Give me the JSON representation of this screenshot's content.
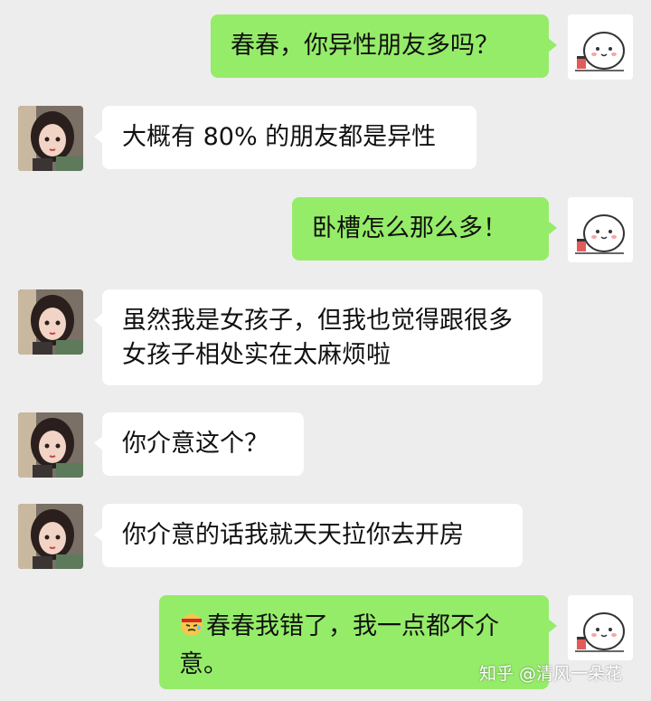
{
  "colors": {
    "background": "#ededed",
    "my_bubble": "#95ec69",
    "her_bubble": "#ffffff",
    "text": "#111111"
  },
  "icons": {
    "my_avatar": "cartoon-bun-avatar-icon",
    "her_avatar": "girl-portrait-avatar-icon",
    "sweat_emoji": "sweat-smile-emoji-icon"
  },
  "messages": [
    {
      "sender": "me",
      "text": "春春，你异性朋友多吗？"
    },
    {
      "sender": "her",
      "text": "大概有 80% 的朋友都是异性"
    },
    {
      "sender": "me",
      "text": "卧槽怎么那么多！"
    },
    {
      "sender": "her",
      "text": "虽然我是女孩子，但我也觉得跟很多女孩子相处实在太麻烦啦"
    },
    {
      "sender": "her",
      "text": "你介意这个？"
    },
    {
      "sender": "her",
      "text": "你介意的话我就天天拉你去开房"
    },
    {
      "sender": "me",
      "text": "春春我错了，我一点都不介意。"
    }
  ],
  "watermark": "知乎 @清风一朵花"
}
